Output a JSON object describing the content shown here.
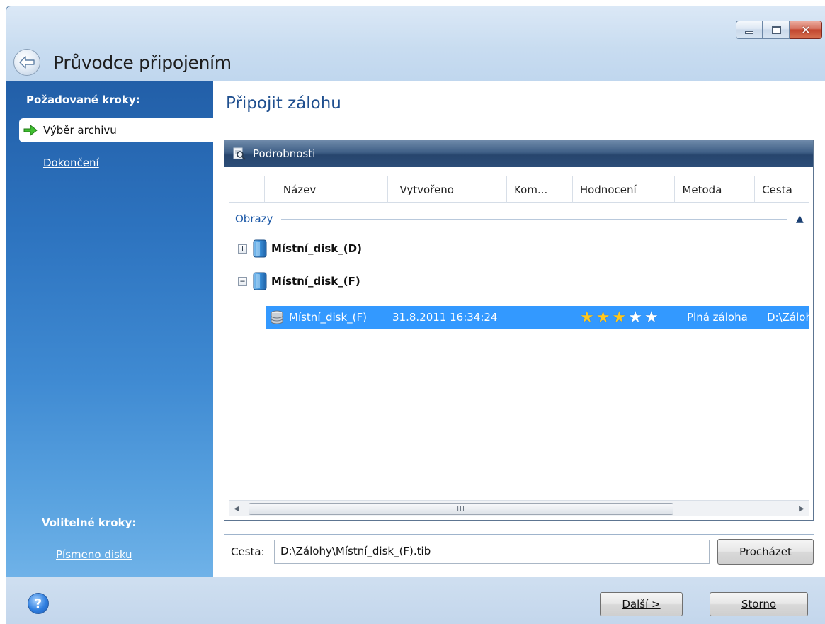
{
  "window": {
    "title": "Průvodce připojením",
    "controls": {
      "minimize": "minimize",
      "maximize": "maximize",
      "close": "close"
    }
  },
  "sidebar": {
    "required_heading": "Požadované kroky:",
    "steps": [
      {
        "label": "Výběr archivu",
        "active": true
      },
      {
        "label": "Dokončení",
        "active": false
      }
    ],
    "optional_heading": "Volitelné kroky:",
    "optional_steps": [
      {
        "label": "Písmeno disku"
      }
    ]
  },
  "main": {
    "title": "Připojit zálohu",
    "panel_title": "Podrobnosti",
    "columns": [
      "Název",
      "Vytvořeno",
      "Kom...",
      "Hodnocení",
      "Metoda",
      "Cesta"
    ],
    "group_label": "Obrazy",
    "tree": [
      {
        "label": "Místní_disk_(D)",
        "expander": "+",
        "expanded": false
      },
      {
        "label": "Místní_disk_(F)",
        "expander": "−",
        "expanded": true
      }
    ],
    "selected_row": {
      "name": "Místní_disk_(F)",
      "created": "31.8.2011 16:34:24",
      "comment": "",
      "rating_stars": 5,
      "rating_filled": 3,
      "method": "Plná záloha",
      "path": "D:\\Zálohy"
    },
    "scroll_grip": "III"
  },
  "path_bar": {
    "label": "Cesta:",
    "value": "D:\\Zálohy\\Místní_disk_(F).tib",
    "browse_label": "Procházet"
  },
  "footer": {
    "help_glyph": "?",
    "next_label": "Další >",
    "cancel_label": "Storno"
  },
  "colors": {
    "selection": "#3399ff",
    "title_blue": "#1f4f8f",
    "sidebar_top": "#225fa8",
    "star_gold": "#ffc81e"
  }
}
